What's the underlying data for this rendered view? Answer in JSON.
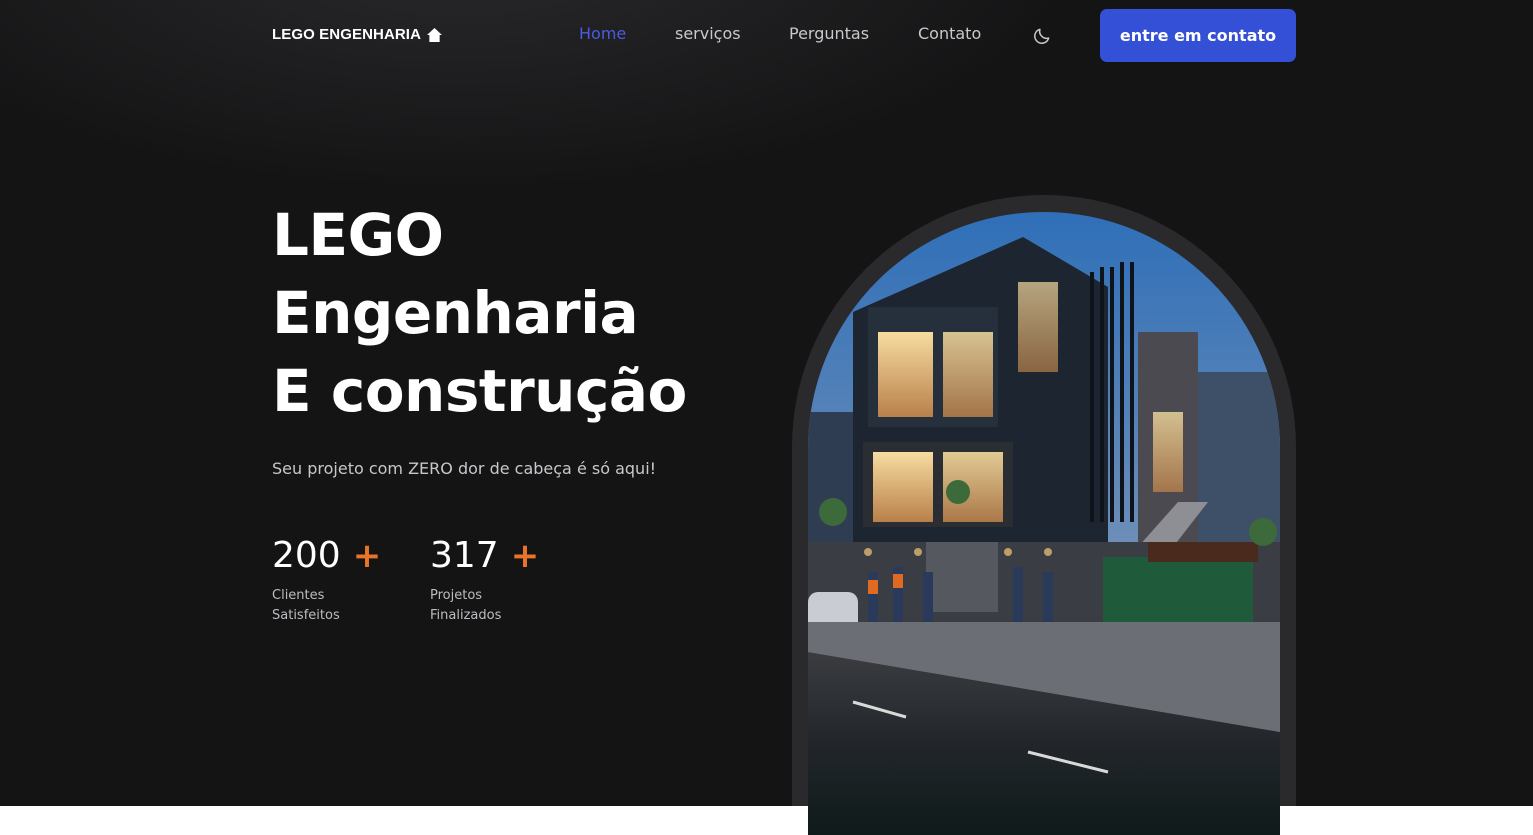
{
  "nav": {
    "logo_text": "LEGO ENGENHARIA",
    "logo_icon": "home-icon",
    "links": [
      {
        "label": "Home",
        "active": true
      },
      {
        "label": "serviços",
        "active": false
      },
      {
        "label": "Perguntas",
        "active": false
      },
      {
        "label": "Contato",
        "active": false
      }
    ],
    "theme_icon": "moon-icon",
    "cta_label": "entre em contato"
  },
  "hero": {
    "title_lines": [
      "LEGO",
      "Engenharia",
      "E construção"
    ],
    "subtitle": "Seu projeto com ZERO dor de cabeça é só aqui!",
    "stats": [
      {
        "value": "200",
        "plus": "+",
        "label_lines": [
          "Clientes",
          "Satisfeitos"
        ]
      },
      {
        "value": "317",
        "plus": "+",
        "label_lines": [
          "Projetos",
          "Finalizados"
        ]
      }
    ],
    "image_icon": "house-construction-illustration"
  },
  "colors": {
    "background": "#141415",
    "accent": "#3450d6",
    "active_link": "#4a5be0",
    "plus_orange": "#e8742a"
  }
}
